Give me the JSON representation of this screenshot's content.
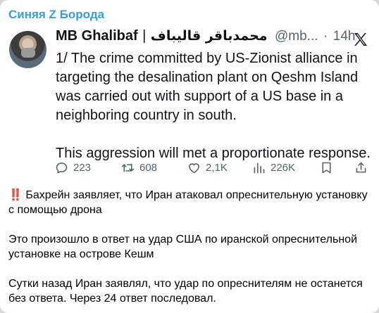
{
  "channel": {
    "name": "Синяя Z Борода"
  },
  "tweet": {
    "author_name": "MB Ghalibaf",
    "separator": "|",
    "author_name_persian": "محمدباقر قالیباف",
    "handle": "@mb...",
    "dot": "·",
    "time": "14h",
    "text": [
      "1/ The crime committed by US-Zionist alliance in targeting the desalination plant on Qeshm Island was carried out with support of a US base in a neighboring country in south.",
      "This aggression will met a proportionate response."
    ],
    "stats": {
      "replies": "223",
      "retweets": "608",
      "likes": "2,1K",
      "views": "226K"
    }
  },
  "message": {
    "alert_icon": "‼️",
    "paragraphs": [
      "Бахрейн заявляет, что Иран атаковал опреснительную установку с помощью дрона",
      "Это произошло в ответ на удар США по иранской опреснительной установке на острове Кешм",
      "Сутки назад Иран заявлял, что удар по опреснителям не останется без ответа. Через 24 ответ последовал."
    ]
  },
  "colors": {
    "channel_name": "#3a9fcf",
    "text": "#0f1419",
    "muted": "#536471",
    "alert": "#e0245e"
  }
}
